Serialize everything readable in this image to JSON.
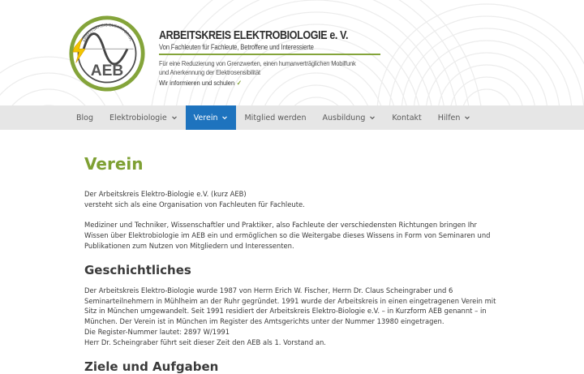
{
  "header": {
    "logo_text": "AEB",
    "logo_ring_text": "ARBEITSKREIS ELEKTROBIOLOGIE e.V.",
    "title": "ARBEITSKREIS ELEKTROBIOLOGIE e. V.",
    "subtitle": "Von Fachleuten für Fachleute, Betroffene und Interessierte",
    "mission_line1": "Für eine Reduzierung von Grenzwerten, einen humanverträglichen Mobilfunk",
    "mission_line2": "und Anerkennung der Elektrosensibilität",
    "tagline": "Wir informieren und schulen",
    "accent_color": "#84a43a"
  },
  "nav": {
    "items": [
      {
        "label": "Blog"
      },
      {
        "label": "Elektrobiologie"
      },
      {
        "label": "Verein"
      },
      {
        "label": "Mitglied werden"
      },
      {
        "label": "Ausbildung"
      },
      {
        "label": "Kontakt"
      },
      {
        "label": "Hilfen"
      }
    ],
    "active_color": "#1e73be"
  },
  "main": {
    "title": "Verein",
    "intro_line1": "Der Arbeitskreis Elektro-Biologie e.V. (kurz AEB)",
    "intro_line2": "versteht sich als eine Organisation von Fachleuten für Fachleute.",
    "paragraph2": "Mediziner und Techniker, Wissenschaftler und Praktiker, also Fachleute der verschiedensten Richtungen bringen Ihr Wissen über Elektrobiologie im AEB ein und ermöglichen so die Weitergabe dieses Wissens in Form von Seminaren und Publikationen zum Nutzen von Mitgliedern und Interessenten.",
    "section1_title": "Geschichtliches",
    "history": "Der Arbeitskreis Elektro-Biologie wurde 1987 von Herrn Erich W. Fischer, Herrn Dr. Claus Scheingraber und 6 Seminarteilnehmern in Mühlheim an der Ruhr gegründet. 1991 wurde der Arbeitskreis in einen eingetragenen Verein mit Sitz in München umgewandelt. Seit 1991 residiert der Arbeitskreis Elektro-Biologie e.V. – in Kurzform AEB genannt – in München. Der Verein ist in München im Register des Amtsgerichts unter der Nummer 13980 eingetragen.",
    "register": "Die Register-Nummer lautet: 2897 W/1991",
    "chair": "Herr Dr. Scheingraber führt seit dieser Zeit den AEB als 1. Vorstand an.",
    "section2_title": "Ziele und Aufgaben",
    "title_color": "#7ea033"
  }
}
